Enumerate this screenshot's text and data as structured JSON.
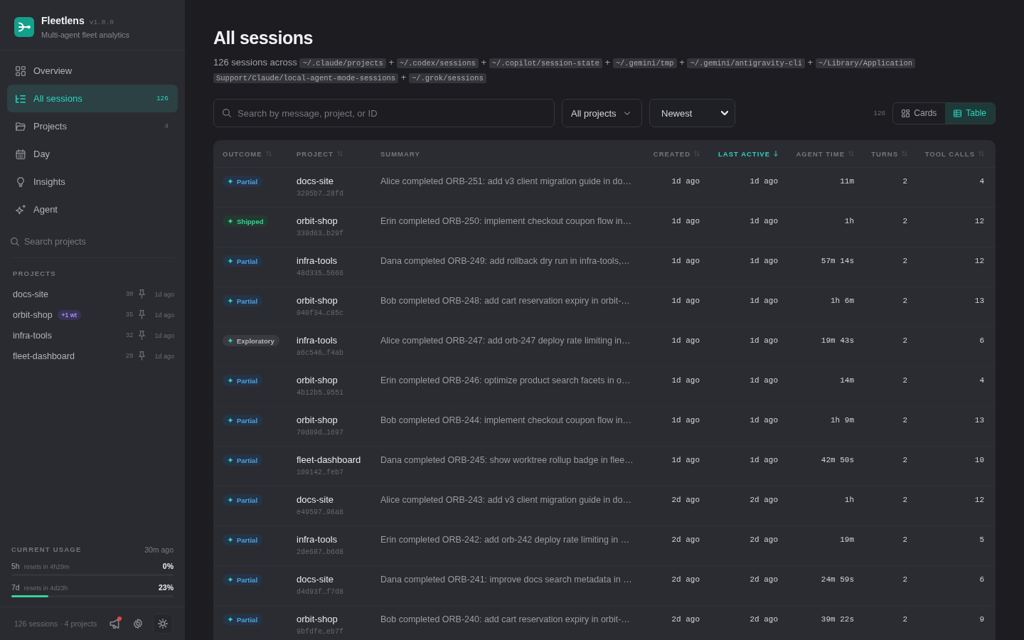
{
  "sidebar": {
    "app": {
      "name": "Fleetlens",
      "version": "v1.0.0",
      "tagline": "Multi-agent fleet analytics"
    },
    "nav": [
      {
        "label": "Overview",
        "selected": false
      },
      {
        "label": "All sessions",
        "count": "126",
        "selected": true
      },
      {
        "label": "Projects",
        "count": "4",
        "selected": false
      },
      {
        "label": "Day",
        "selected": false
      },
      {
        "label": "Insights",
        "selected": false
      },
      {
        "label": "Agent",
        "selected": false
      }
    ],
    "search": {
      "placeholder": "Search projects"
    },
    "projects": {
      "title": "PROJECTS",
      "items": [
        {
          "name": "docs-site",
          "count": "30",
          "last_active": "1d ago"
        },
        {
          "name": "orbit-shop",
          "worktrees": "+1 wt",
          "count": "35",
          "last_active": "1d ago"
        },
        {
          "name": "infra-tools",
          "count": "32",
          "last_active": "1d ago"
        },
        {
          "name": "fleet-dashboard",
          "count": "29",
          "last_active": "1d ago"
        }
      ]
    },
    "usage": {
      "title": "CURRENT USAGE",
      "updated": "30m ago",
      "windows": [
        {
          "label": "5h",
          "reset": "resets in 4h29m",
          "percent": "0%",
          "level": 0
        },
        {
          "label": "7d",
          "reset": "resets in 4d23h",
          "percent": "23%",
          "level": 0.23
        }
      ]
    },
    "footer": {
      "summary": "126 sessions · 4 projects",
      "unread": true
    }
  },
  "page": {
    "title": "All sessions",
    "sources": {
      "lead": "126 sessions across",
      "separator": "+",
      "paths": [
        "~/.claude/projects",
        "~/.codex/sessions",
        "~/.copilot/session-state",
        "~/.gemini/tmp",
        "~/.gemini/antigravity-cli",
        "~/Library/Application Support/Claude/local-agent-mode-sessions",
        "~/.grok/sessions"
      ]
    }
  },
  "toolbar": {
    "search": {
      "placeholder": "Search by message, project, or ID"
    },
    "project_filter": "All projects",
    "sort": "Newest",
    "count": "126",
    "views": [
      {
        "label": "Cards",
        "selected": false
      },
      {
        "label": "Table",
        "selected": true
      }
    ]
  },
  "table": {
    "columns": [
      {
        "label": "OUTCOME",
        "sortable": true,
        "sorted": false
      },
      {
        "label": "PROJECT",
        "sortable": true,
        "sorted": false
      },
      {
        "label": "SUMMARY",
        "sortable": false,
        "sorted": false
      },
      {
        "label": "CREATED",
        "sortable": true,
        "sorted": false
      },
      {
        "label": "LAST ACTIVE",
        "sortable": true,
        "sorted": true
      },
      {
        "label": "AGENT TIME",
        "sortable": true,
        "sorted": false
      },
      {
        "label": "TURNS",
        "sortable": true,
        "sorted": false
      },
      {
        "label": "TOOL CALLS",
        "sortable": true,
        "sorted": false
      }
    ],
    "rows": [
      {
        "outcome": {
          "label": "Partial",
          "kind": "partial"
        },
        "project": "docs-site",
        "id": "3295b7…28fd",
        "summary": "Alice completed ORB-251: add v3 client migration guide in do…",
        "created": "1d ago",
        "last_active": "1d ago",
        "agent_time": "11m",
        "turns": "2",
        "tool_calls": "4"
      },
      {
        "outcome": {
          "label": "Shipped",
          "kind": "shipped"
        },
        "project": "orbit-shop",
        "id": "339d63…b29f",
        "summary": "Erin completed ORB-250: implement checkout coupon flow in…",
        "created": "1d ago",
        "last_active": "1d ago",
        "agent_time": "1h",
        "turns": "2",
        "tool_calls": "12"
      },
      {
        "outcome": {
          "label": "Partial",
          "kind": "partial"
        },
        "project": "infra-tools",
        "id": "48d335…5666",
        "summary": "Dana completed ORB-249: add rollback dry run in infra-tools,…",
        "created": "1d ago",
        "last_active": "1d ago",
        "agent_time": "57m 14s",
        "turns": "2",
        "tool_calls": "12"
      },
      {
        "outcome": {
          "label": "Partial",
          "kind": "partial"
        },
        "project": "orbit-shop",
        "id": "040f34…c85c",
        "summary": "Bob completed ORB-248: add cart reservation expiry in orbit-…",
        "created": "1d ago",
        "last_active": "1d ago",
        "agent_time": "1h 6m",
        "turns": "2",
        "tool_calls": "13"
      },
      {
        "outcome": {
          "label": "Exploratory",
          "kind": "exploratory"
        },
        "project": "infra-tools",
        "id": "a6c546…f4ab",
        "summary": "Alice completed ORB-247: add orb-247 deploy rate limiting in…",
        "created": "1d ago",
        "last_active": "1d ago",
        "agent_time": "19m 43s",
        "turns": "2",
        "tool_calls": "6"
      },
      {
        "outcome": {
          "label": "Partial",
          "kind": "partial"
        },
        "project": "orbit-shop",
        "id": "4b12b5…9551",
        "summary": "Erin completed ORB-246: optimize product search facets in o…",
        "created": "1d ago",
        "last_active": "1d ago",
        "agent_time": "14m",
        "turns": "2",
        "tool_calls": "4"
      },
      {
        "outcome": {
          "label": "Partial",
          "kind": "partial"
        },
        "project": "orbit-shop",
        "id": "70d89d…1697",
        "summary": "Bob completed ORB-244: implement checkout coupon flow in…",
        "created": "1d ago",
        "last_active": "1d ago",
        "agent_time": "1h 9m",
        "turns": "2",
        "tool_calls": "13"
      },
      {
        "outcome": {
          "label": "Partial",
          "kind": "partial"
        },
        "project": "fleet-dashboard",
        "id": "109142…feb7",
        "summary": "Dana completed ORB-245: show worktree rollup badge in flee…",
        "created": "1d ago",
        "last_active": "1d ago",
        "agent_time": "42m 50s",
        "turns": "2",
        "tool_calls": "10"
      },
      {
        "outcome": {
          "label": "Partial",
          "kind": "partial"
        },
        "project": "docs-site",
        "id": "e49597…96a8",
        "summary": "Alice completed ORB-243: add v3 client migration guide in do…",
        "created": "2d ago",
        "last_active": "2d ago",
        "agent_time": "1h",
        "turns": "2",
        "tool_calls": "12"
      },
      {
        "outcome": {
          "label": "Partial",
          "kind": "partial"
        },
        "project": "infra-tools",
        "id": "2de687…b6d8",
        "summary": "Erin completed ORB-242: add orb-242 deploy rate limiting in …",
        "created": "2d ago",
        "last_active": "2d ago",
        "agent_time": "19m",
        "turns": "2",
        "tool_calls": "5"
      },
      {
        "outcome": {
          "label": "Partial",
          "kind": "partial"
        },
        "project": "docs-site",
        "id": "d4d93f…f7d8",
        "summary": "Dana completed ORB-241: improve docs search metadata in …",
        "created": "2d ago",
        "last_active": "2d ago",
        "agent_time": "24m 59s",
        "turns": "2",
        "tool_calls": "6"
      },
      {
        "outcome": {
          "label": "Partial",
          "kind": "partial"
        },
        "project": "orbit-shop",
        "id": "9bfdfe…eb7f",
        "summary": "Bob completed ORB-240: add cart reservation expiry in orbit-…",
        "created": "2d ago",
        "last_active": "2d ago",
        "agent_time": "39m 22s",
        "turns": "2",
        "tool_calls": "9"
      }
    ]
  }
}
